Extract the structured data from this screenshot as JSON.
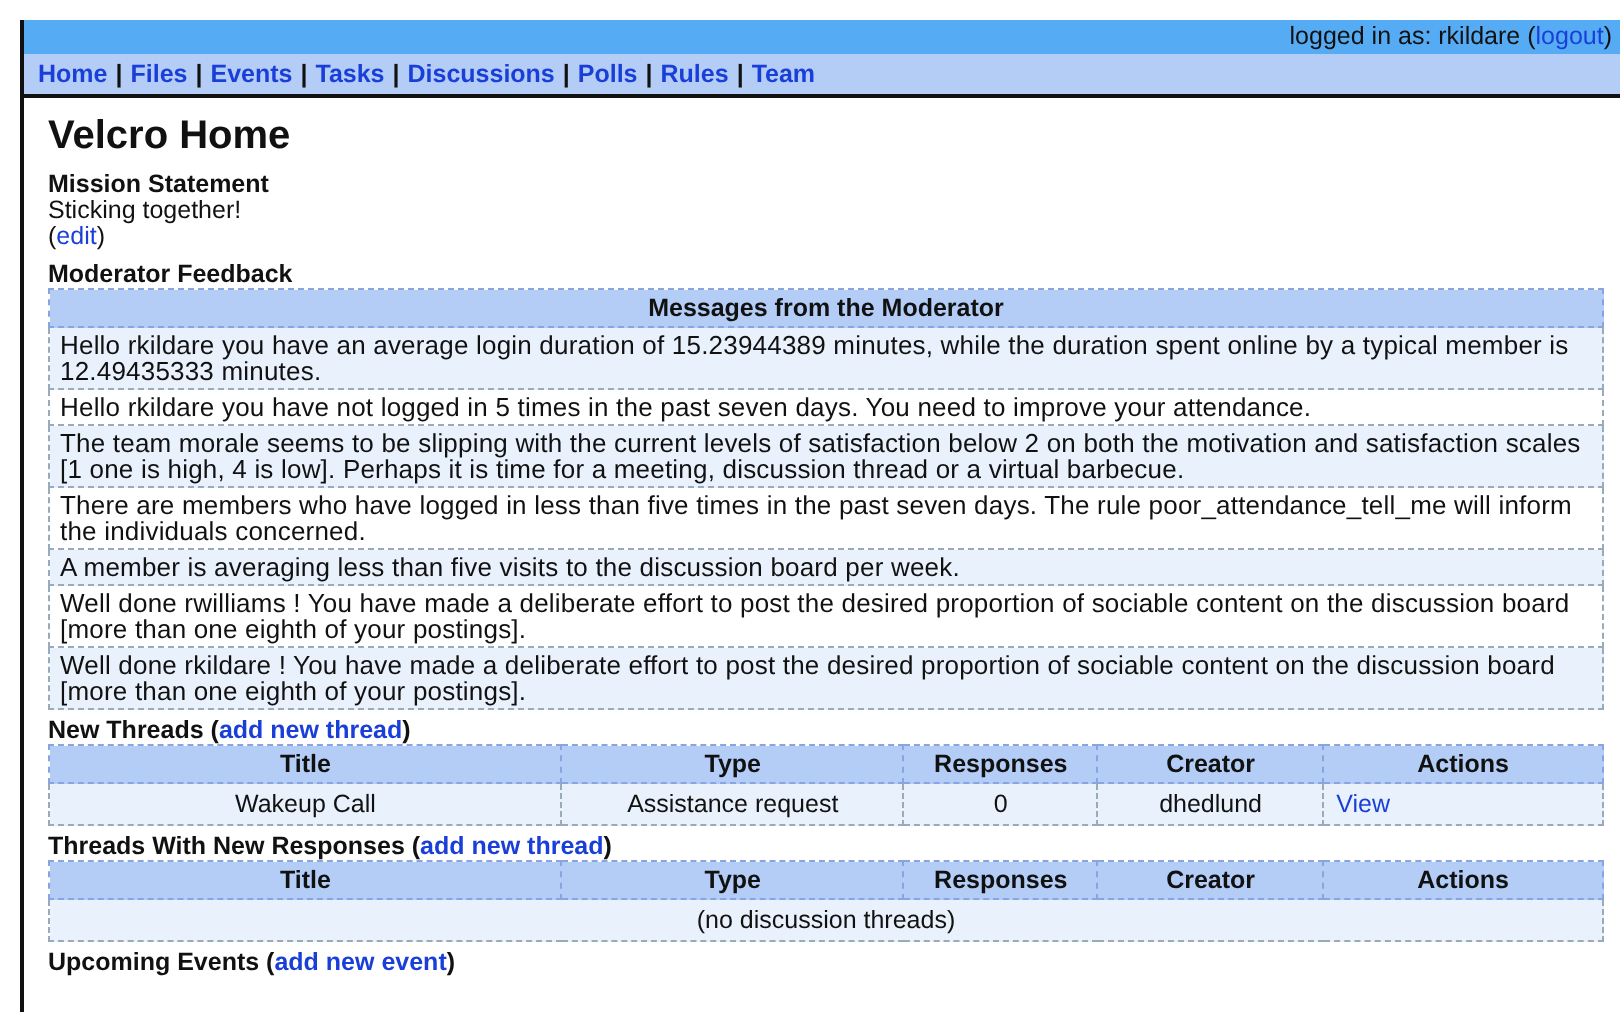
{
  "top_bar": {
    "prefix": "logged in as: rkildare (",
    "link": "logout",
    "suffix": ")"
  },
  "nav": {
    "separator": "|",
    "items": [
      "Home",
      "Files",
      "Events",
      "Tasks",
      "Discussions",
      "Polls",
      "Rules",
      "Team"
    ]
  },
  "title": "Velcro Home",
  "mission": {
    "heading": "Mission Statement",
    "text": "Sticking together!",
    "open": "(",
    "link": "edit",
    "close": ")"
  },
  "feedback": {
    "heading": "Moderator Feedback",
    "table_title": "Messages from the Moderator",
    "messages": [
      "Hello rkildare you have an average login duration of 15.23944389 minutes, while the duration spent online by a typical member is 12.49435333 minutes.",
      "Hello rkildare you have not logged in 5 times in the past seven days. You need to improve your attendance.",
      "The team morale seems to be slipping with the current levels of satisfaction below 2 on both the motivation and satisfaction scales [1 one is high, 4 is low]. Perhaps it is time for a meeting, discussion thread or a virtual barbecue.",
      "There are members who have logged in less than five times in the past seven days. The rule poor_attendance_tell_me will inform the individuals concerned.",
      "A member is averaging less than five visits to the discussion board per week.",
      "Well done rwilliams ! You have made a deliberate effort to post the desired proportion of sociable content on the discussion board [more than one eighth of your postings].",
      "Well done rkildare ! You have made a deliberate effort to post the desired proportion of sociable content on the discussion board [more than one eighth of your postings]."
    ]
  },
  "sections": [
    {
      "prefix": "New Threads (",
      "link": "add new thread",
      "suffix": ")",
      "columns": [
        "Title",
        "Type",
        "Responses",
        "Creator",
        "Actions"
      ],
      "rows": [
        [
          "Wakeup Call",
          "Assistance request",
          "0",
          "dhedlund",
          "View"
        ]
      ]
    },
    {
      "prefix": "Threads With New Responses (",
      "link": "add new thread",
      "suffix": ")",
      "columns": [
        "Title",
        "Type",
        "Responses",
        "Creator",
        "Actions"
      ],
      "empty": "(no discussion threads)"
    },
    {
      "prefix": "Upcoming Events (",
      "link": "add new event",
      "suffix": ")"
    }
  ]
}
